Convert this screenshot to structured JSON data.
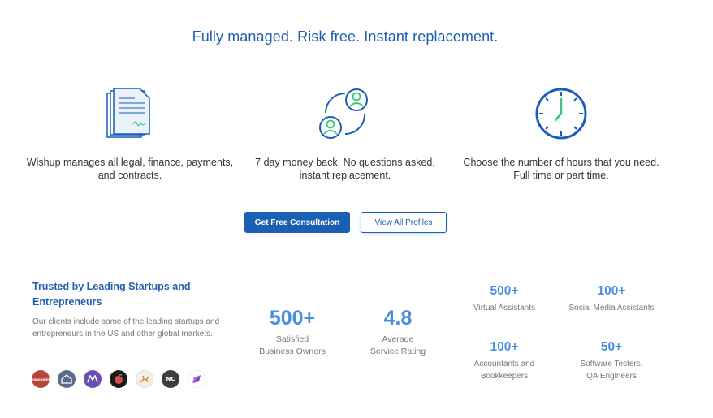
{
  "headline": "Fully managed. Risk free. Instant replacement.",
  "features": [
    {
      "icon": "legal-documents-icon",
      "text": "Wishup manages all legal, finance, payments, and contracts."
    },
    {
      "icon": "replacement-users-icon",
      "text": "7 day money back. No questions asked, instant replacement."
    },
    {
      "icon": "clock-icon",
      "text": "Choose the number of hours that you need. Full time or part time."
    }
  ],
  "buttons": {
    "primary": "Get Free Consultation",
    "secondary": "View All Profiles"
  },
  "trust": {
    "title": "Trusted by Leading Startups and Entrepreneurs",
    "description": "Our clients include some of the leading startups and entrepreneurs in the US and other global markets.",
    "logos": [
      {
        "name": "nanopoint-logo",
        "color": "#b5473a",
        "text": "nanopoint"
      },
      {
        "name": "home-logo",
        "color": "#5d6b8a",
        "text": ""
      },
      {
        "name": "m-logo",
        "color": "#6b4fb0",
        "text": ""
      },
      {
        "name": "fruit-logo",
        "color": "#1a1a1a",
        "text": ""
      },
      {
        "name": "deer-logo",
        "color": "#f4efe6",
        "text": ""
      },
      {
        "name": "nc-logo",
        "color": "#3d3d3d",
        "text": "NC"
      },
      {
        "name": "arrow-logo",
        "color": "#ffffff",
        "text": ""
      }
    ]
  },
  "stats_big": [
    {
      "num": "500+",
      "label1": "Satisfied",
      "label2": "Business Owners"
    },
    {
      "num": "4.8",
      "label1": "Average",
      "label2": "Service Rating"
    }
  ],
  "stats_small": [
    {
      "num": "500+",
      "label1": "Virtual Assistants",
      "label2": ""
    },
    {
      "num": "100+",
      "label1": "Social Media Assistants",
      "label2": ""
    },
    {
      "num": "100+",
      "label1": "Accountants and",
      "label2": "Bookkeepers"
    },
    {
      "num": "50+",
      "label1": "Software Testers,",
      "label2": "QA Engineers"
    }
  ]
}
